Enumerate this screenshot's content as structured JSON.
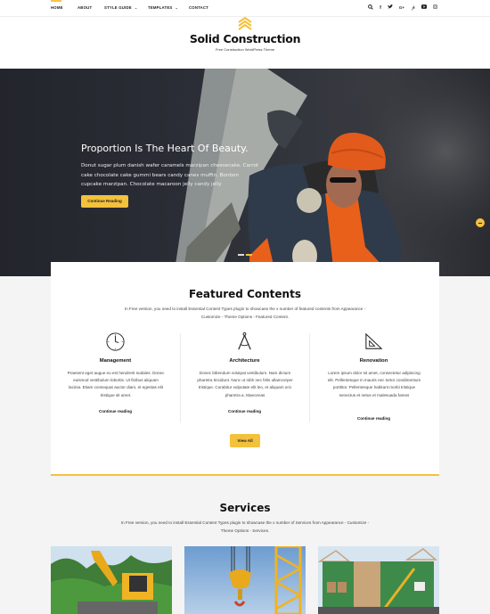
{
  "nav": {
    "items": [
      {
        "label": "HOME",
        "active": true
      },
      {
        "label": "ABOUT"
      },
      {
        "label": "STYLE GUIDE",
        "dropdown": true
      },
      {
        "label": "TEMPLATES",
        "dropdown": true
      },
      {
        "label": "CONTACT"
      }
    ],
    "social_icons": [
      "search-icon",
      "facebook-icon",
      "twitter-icon",
      "google-plus-icon",
      "pinterest-icon",
      "youtube-icon",
      "instagram-icon"
    ],
    "social_glyphs": [
      "⚲",
      "f",
      "✦",
      "G+",
      "℗",
      "▶",
      "◻"
    ]
  },
  "header": {
    "title": "Solid Construction",
    "tagline": "Free Construction WordPress Theme"
  },
  "hero": {
    "title": "Proportion Is The Heart Of Beauty.",
    "text": "Donut sugar plum danish wafer caramels marzipan cheesecake. Carrot cake chocolate cake gummi bears candy canes muffin. Bonbon cupcake marzipan. Chocolate macaroon jelly candy jelly",
    "button": "Continue Reading",
    "slides": 2,
    "active_slide": 2
  },
  "featured": {
    "title": "Featured Contents",
    "description": "In Free version, you need to install Essential Content Types plugin to showcase the x number of featured contents from Appearance - Customize - Theme Options - Featured Content.",
    "items": [
      {
        "icon": "clock-icon",
        "title": "Management",
        "text": "Praesent eget augue eu est hendrerit sodales. Donec euismod vestibulum lobortis. Ut finibus aliquam lacinia. Etiam consequat auctor diam, et egestas elit tristique sit amet.",
        "link": "Continue reading"
      },
      {
        "icon": "compass-icon",
        "title": "Architecture",
        "text": "Donec bibendum volutpat vestibulum. Nam dictum pharetra tincidunt. Nunc ut nibh nec felis ullamcorper tristique. Curabitur vulputate elit leo, et aliquam orci pharetra a. Maecenas",
        "link": "Continue reading"
      },
      {
        "icon": "set-square-icon",
        "title": "Renovation",
        "text": "Lorem ipsum dolor sit amet, consectetur adipiscing elit. Pellentesque in mauris nec tortor condimentum porttitor. Pellentesque habitant morbi tristique senectus et netus et malesuada fames",
        "link": "Continue reading"
      }
    ],
    "view_all": "View All"
  },
  "services": {
    "title": "Services",
    "description": "In Free version, you need to install Essential Content Types plugin to showcase the x number of Services from Appearance - Customize - Theme Options - Services.",
    "images": [
      "excavator-image",
      "crane-hook-image",
      "house-frame-image"
    ]
  },
  "colors": {
    "accent": "#f4c13c",
    "hero_bg": "#2b2e36"
  }
}
